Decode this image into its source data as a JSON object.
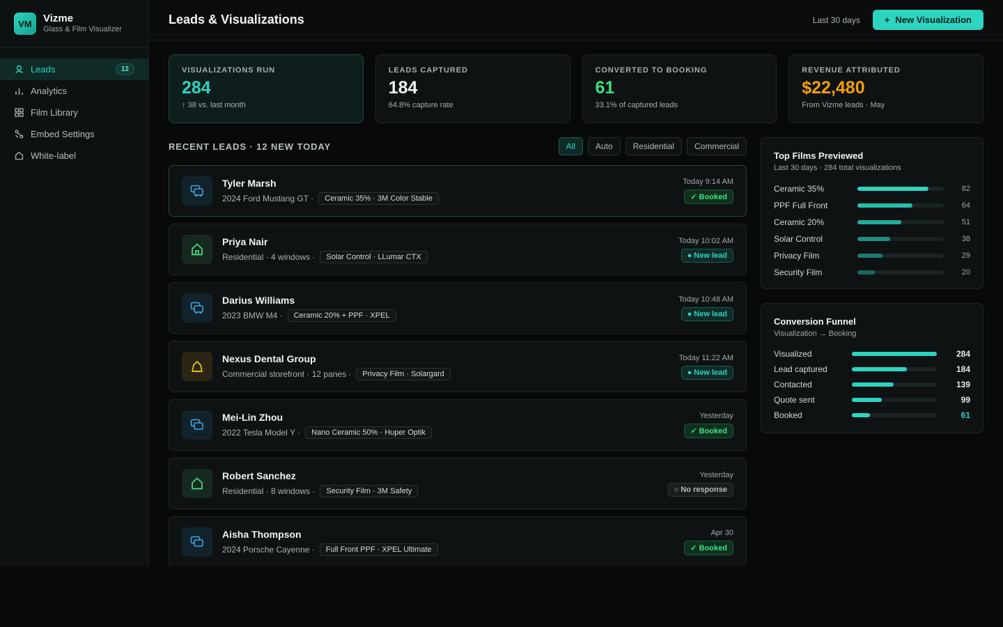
{
  "brand": {
    "logo": "VM",
    "name": "Vizme",
    "subtitle": "Glass & Film Visualizer"
  },
  "sidebar": {
    "items": [
      {
        "label": "Leads",
        "icon": "user-icon",
        "badge": "12",
        "active": true
      },
      {
        "label": "Analytics",
        "icon": "bar-chart-icon"
      },
      {
        "label": "Film Library",
        "icon": "grid-icon"
      },
      {
        "label": "Embed Settings",
        "icon": "code-icon"
      },
      {
        "label": "White-label",
        "icon": "tag-icon"
      }
    ]
  },
  "header": {
    "title": "Leads & Visualizations",
    "range": "Last 30 days",
    "new_button": "New Visualization"
  },
  "stats": [
    {
      "label": "VISUALIZATIONS RUN",
      "value": "284",
      "sub": "↑ 38 vs. last month",
      "color": "#2dd4bf"
    },
    {
      "label": "LEADS CAPTURED",
      "value": "184",
      "sub": "64.8% capture rate",
      "color": "#f2f5f4"
    },
    {
      "label": "CONVERTED TO BOOKING",
      "value": "61",
      "sub": "33.1% of captured leads",
      "color": "#3ee07e"
    },
    {
      "label": "REVENUE ATTRIBUTED",
      "value": "$22,480",
      "sub": "From Vizme leads · May",
      "color": "#f59e0b"
    }
  ],
  "leads_section": {
    "title": "RECENT LEADS · 12 NEW TODAY",
    "filters": [
      "All",
      "Auto",
      "Residential",
      "Commercial"
    ],
    "active_filter": "All"
  },
  "leads": [
    {
      "name": "Tyler Marsh",
      "detail": "2024 Ford Mustang GT ·",
      "film": "Ceramic 35% · 3M Color Stable",
      "time": "Today 9:14 AM",
      "status": "✓ Booked",
      "status_type": "booked",
      "kind": "auto"
    },
    {
      "name": "Priya Nair",
      "detail": "Residential · 4 windows ·",
      "film": "Solar Control · LLumar CTX",
      "time": "Today 10:02 AM",
      "status": "● New lead",
      "status_type": "new",
      "kind": "residential"
    },
    {
      "name": "Darius Williams",
      "detail": "2023 BMW M4 ·",
      "film": "Ceramic 20% + PPF · XPEL",
      "time": "Today 10:48 AM",
      "status": "● New lead",
      "status_type": "new",
      "kind": "auto"
    },
    {
      "name": "Nexus Dental Group",
      "detail": "Commercial storefront · 12 panes ·",
      "film": "Privacy Film · Solargard",
      "time": "Today 11:22 AM",
      "status": "● New lead",
      "status_type": "new",
      "kind": "commercial"
    },
    {
      "name": "Mei-Lin Zhou",
      "detail": "2022 Tesla Model Y ·",
      "film": "Nano Ceramic 50% · Huper Optik",
      "time": "Yesterday",
      "status": "✓ Booked",
      "status_type": "booked",
      "kind": "auto"
    },
    {
      "name": "Robert Sanchez",
      "detail": "Residential · 8 windows ·",
      "film": "Security Film · 3M Safety",
      "time": "Yesterday",
      "status": "○ No response",
      "status_type": "none",
      "kind": "residential"
    },
    {
      "name": "Aisha Thompson",
      "detail": "2024 Porsche Cayenne ·",
      "film": "Full Front PPF · XPEL Ultimate",
      "time": "Apr 30",
      "status": "✓ Booked",
      "status_type": "booked",
      "kind": "auto"
    }
  ],
  "top_films": {
    "title": "Top Films Previewed",
    "subtitle": "Last 30 days · 284 total visualizations",
    "max": 100,
    "items": [
      {
        "name": "Ceramic 35%",
        "count": 82
      },
      {
        "name": "PPF Full Front",
        "count": 64
      },
      {
        "name": "Ceramic 20%",
        "count": 51
      },
      {
        "name": "Solar Control",
        "count": 38
      },
      {
        "name": "Privacy Film",
        "count": 29
      },
      {
        "name": "Security Film",
        "count": 20
      }
    ]
  },
  "funnel": {
    "title": "Conversion Funnel",
    "subtitle": "Visualization → Booking",
    "max": 284,
    "items": [
      {
        "name": "Visualized",
        "count": 284
      },
      {
        "name": "Lead captured",
        "count": 184
      },
      {
        "name": "Contacted",
        "count": 139
      },
      {
        "name": "Quote sent",
        "count": 99
      },
      {
        "name": "Booked",
        "count": 61,
        "highlight": true
      }
    ]
  },
  "colors": {
    "accent": "#2dd4bf",
    "success": "#3ee07e",
    "warning": "#f59e0b"
  }
}
